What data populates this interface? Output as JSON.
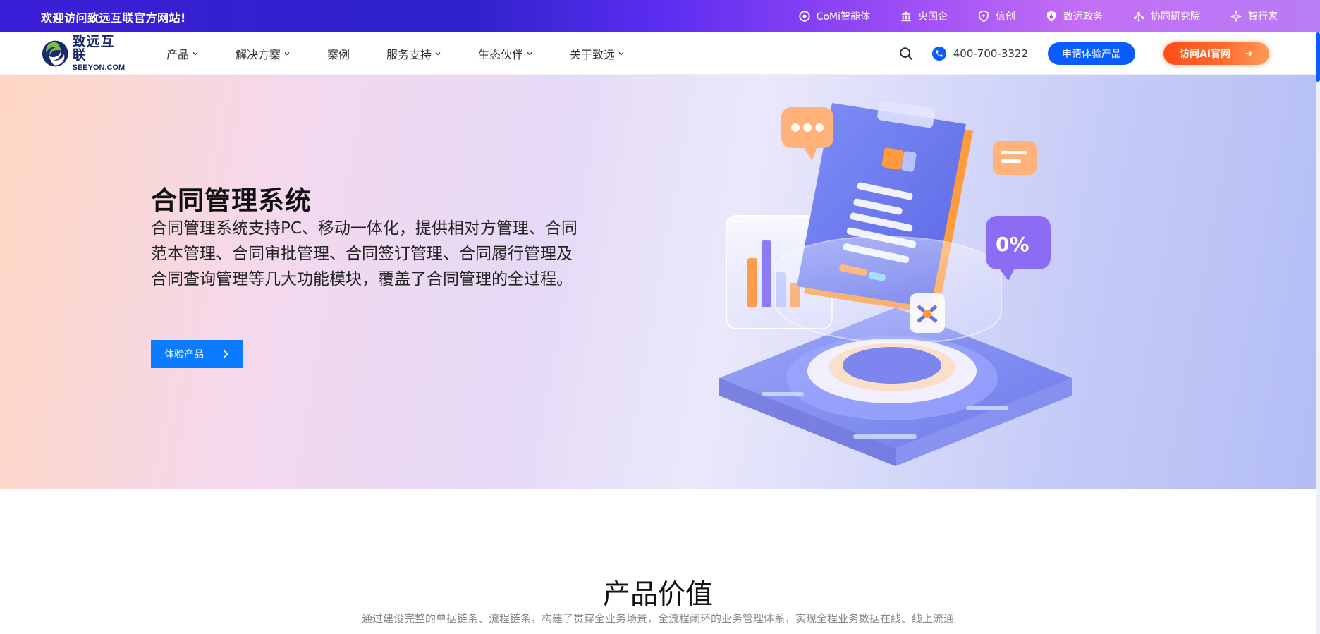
{
  "topbar": {
    "welcome": "欢迎访问致远互联官方网站!",
    "links": [
      {
        "label": "CoMi智能体",
        "icon": "comi-icon"
      },
      {
        "label": "央国企",
        "icon": "building-icon"
      },
      {
        "label": "信创",
        "icon": "shield-icon"
      },
      {
        "label": "致远政务",
        "icon": "badge-icon"
      },
      {
        "label": "协同研究院",
        "icon": "network-icon"
      },
      {
        "label": "智行家",
        "icon": "sparkle-icon"
      }
    ]
  },
  "nav": {
    "logo_cn": "致远互联",
    "logo_en": "SEEYON.COM",
    "menu": [
      {
        "label": "产品",
        "has_dropdown": true
      },
      {
        "label": "解决方案",
        "has_dropdown": true
      },
      {
        "label": "案例",
        "has_dropdown": false
      },
      {
        "label": "服务支持",
        "has_dropdown": true
      },
      {
        "label": "生态伙伴",
        "has_dropdown": true
      },
      {
        "label": "关于致远",
        "has_dropdown": true
      }
    ],
    "phone": "400-700-3322",
    "apply_label": "申请体验产品",
    "ai_label": "访问AI官网"
  },
  "hero": {
    "title": "合同管理系统",
    "description": "合同管理系统支持PC、移动一体化，提供相对方管理、合同范本管理、合同审批管理、合同签订管理、合同履行管理及合同查询管理等几大功能模块，覆盖了合同管理的全过程。",
    "button_label": "体验产品"
  },
  "section": {
    "title": "产品价值",
    "subtitle": "通过建设完整的单据链条、流程链条，构建了贯穿全业务场景，全流程闭环的业务管理体系，实现全程业务数据在线、线上流通"
  },
  "colors": {
    "brand_blue": "#0b5cff",
    "ai_orange": "#ff5a1f",
    "topbar_start": "#3b1fd8",
    "topbar_end": "#c36ff4"
  }
}
